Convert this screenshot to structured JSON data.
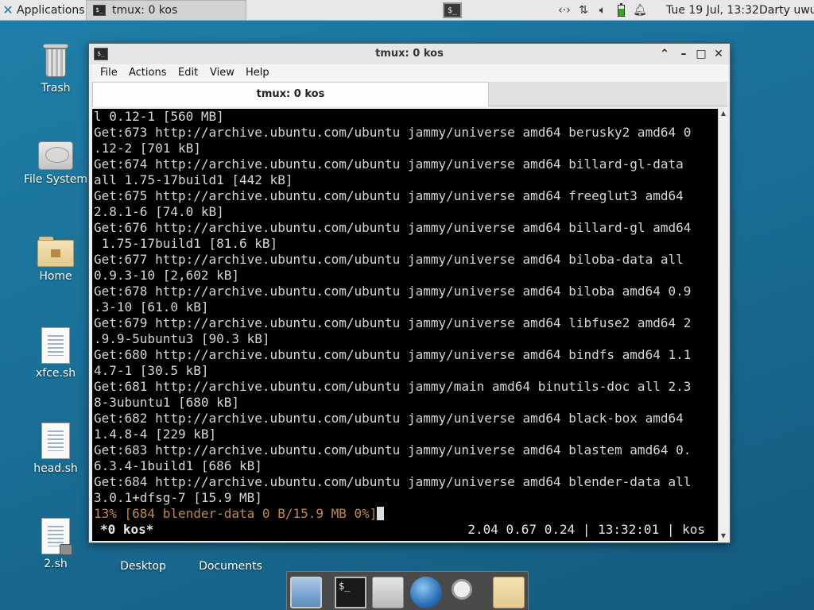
{
  "top_panel": {
    "applications_label": "Applications",
    "task_label": "tmux: 0 kos",
    "clock": "Tue 19 Jul, 13:32",
    "user": "Darty uwu"
  },
  "desktop_icons": {
    "trash": "Trash",
    "file_system": "File System",
    "home": "Home",
    "xfce_sh": "xfce.sh",
    "head_sh": "head.sh",
    "two_sh": "2.sh",
    "desktop": "Desktop",
    "documents": "Documents"
  },
  "window": {
    "title": "tmux: 0 kos",
    "menu": [
      "File",
      "Actions",
      "Edit",
      "View",
      "Help"
    ],
    "tab_label": "tmux: 0 kos"
  },
  "terminal": {
    "lines": [
      "l 0.12-1 [560 MB]",
      "Get:673 http://archive.ubuntu.com/ubuntu jammy/universe amd64 berusky2 amd64 0",
      ".12-2 [701 kB]",
      "Get:674 http://archive.ubuntu.com/ubuntu jammy/universe amd64 billard-gl-data",
      "all 1.75-17build1 [442 kB]",
      "Get:675 http://archive.ubuntu.com/ubuntu jammy/universe amd64 freeglut3 amd64",
      "2.8.1-6 [74.0 kB]",
      "Get:676 http://archive.ubuntu.com/ubuntu jammy/universe amd64 billard-gl amd64",
      " 1.75-17build1 [81.6 kB]",
      "Get:677 http://archive.ubuntu.com/ubuntu jammy/universe amd64 biloba-data all",
      "0.9.3-10 [2,602 kB]",
      "Get:678 http://archive.ubuntu.com/ubuntu jammy/universe amd64 biloba amd64 0.9",
      ".3-10 [61.0 kB]",
      "Get:679 http://archive.ubuntu.com/ubuntu jammy/universe amd64 libfuse2 amd64 2",
      ".9.9-5ubuntu3 [90.3 kB]",
      "Get:680 http://archive.ubuntu.com/ubuntu jammy/universe amd64 bindfs amd64 1.1",
      "4.7-1 [30.5 kB]",
      "Get:681 http://archive.ubuntu.com/ubuntu jammy/main amd64 binutils-doc all 2.3",
      "8-3ubuntu1 [680 kB]",
      "Get:682 http://archive.ubuntu.com/ubuntu jammy/universe amd64 black-box amd64",
      "1.4.8-4 [229 kB]",
      "Get:683 http://archive.ubuntu.com/ubuntu jammy/universe amd64 blastem amd64 0.",
      "6.3.4-1build1 [686 kB]",
      "Get:684 http://archive.ubuntu.com/ubuntu jammy/universe amd64 blender-data all",
      "3.0.1+dfsg-7 [15.9 MB]"
    ],
    "progress_line": "13% [684 blender-data 0 B/15.9 MB 0%]",
    "status_left": "*0 kos*",
    "status_right": "2.04 0.67 0.24 | 13:32:01 | kos"
  }
}
